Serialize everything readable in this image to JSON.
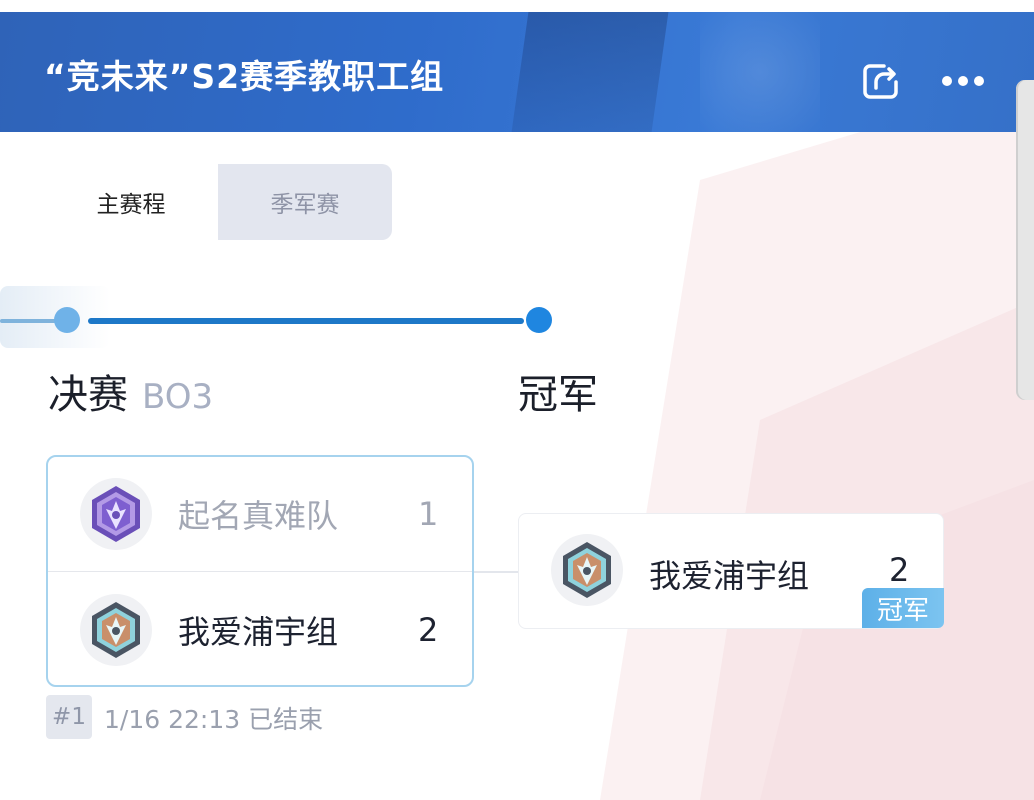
{
  "header": {
    "title": "“竞未来”S2赛季教职工组",
    "share_icon": "share-icon",
    "more_icon": "more-horizontal-icon"
  },
  "tabs": [
    {
      "label": "主赛程",
      "active": true
    },
    {
      "label": "季军赛",
      "active": false
    }
  ],
  "stages": {
    "final_label": "决赛",
    "final_format": "BO3",
    "champion_label": "冠军"
  },
  "match": {
    "teams": [
      {
        "name": "起名真难队",
        "score": "1",
        "winner": false
      },
      {
        "name": "我爱浦宇组",
        "score": "2",
        "winner": true
      }
    ],
    "number": "#1",
    "meta": "1/16 22:13 已结束"
  },
  "champion": {
    "name": "我爱浦宇组",
    "score": "2",
    "badge": "冠军"
  },
  "colors": {
    "header": "#2f6ccb",
    "accent": "#1d78c8",
    "card_border": "#a6d3ee",
    "badge": "#5db0e8"
  }
}
